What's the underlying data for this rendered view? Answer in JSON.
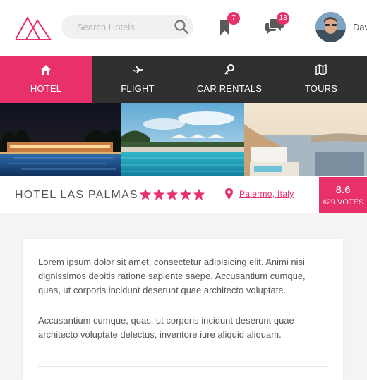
{
  "header": {
    "search": {
      "placeholder": "Search Hotels",
      "icon": "search-icon"
    },
    "bookmarks": {
      "icon": "bookmark-icon",
      "count": "7"
    },
    "messages": {
      "icon": "chat-icon",
      "count": "13"
    },
    "user": {
      "name_visible": "Dav"
    }
  },
  "nav": {
    "tabs": [
      {
        "label": "HOTEL",
        "icon": "home-icon",
        "active": true
      },
      {
        "label": "FLIGHT",
        "icon": "plane-icon",
        "active": false
      },
      {
        "label": "CAR RENTALS",
        "icon": "key-icon",
        "active": false
      },
      {
        "label": "TOURS",
        "icon": "map-icon",
        "active": false
      }
    ]
  },
  "hotel": {
    "name": "HOTEL LAS PALMAS",
    "stars": 5,
    "location": "Palermo, Italy",
    "rating": "8.6",
    "votes": "429 VOTES"
  },
  "description": {
    "paragraph1": "Lorem ipsum dolor sit amet, consectetur adipisicing elit. Animi nisi dignissimos debitis ratione sapiente saepe. Accusantium cumque, quas, ut corporis incidunt deserunt quae architecto voluptate.",
    "paragraph2": "Accusantium cumque, quas, ut corporis incidunt deserunt quae architecto voluptate delectus, inventore iure aliquid aliquam."
  },
  "colors": {
    "accent": "#e8316a",
    "nav_bg": "#303030",
    "page_bg": "#f4f4f4"
  }
}
